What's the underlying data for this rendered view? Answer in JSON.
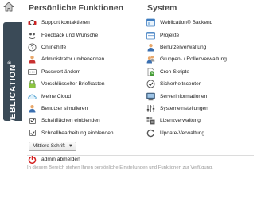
{
  "sidebar": {
    "brand": "WEBLICATION",
    "brand_mark": "®",
    "home_icon": "home-icon"
  },
  "personal": {
    "heading": "Persönliche Funktionen",
    "items": [
      {
        "label": "Support kontaktieren",
        "icon": "support-icon"
      },
      {
        "label": "Feedback und Wünsche",
        "icon": "feedback-icon"
      },
      {
        "label": "Onlinehilfe",
        "icon": "help-icon"
      },
      {
        "label": "Administrator umbenennen",
        "icon": "user-rename-icon"
      },
      {
        "label": "Passwort ändern",
        "icon": "password-icon"
      },
      {
        "label": "Verschlüsselter Briefkasten",
        "icon": "lock-icon"
      },
      {
        "label": "Meine Cloud",
        "icon": "cloud-icon"
      },
      {
        "label": "Benutzer simulieren",
        "icon": "user-simulate-icon"
      }
    ],
    "checkboxes": [
      {
        "label": "Schaltflächen einblenden",
        "checked": true
      },
      {
        "label": "Schnellbearbeitung einblenden",
        "checked": true
      }
    ],
    "font_select": {
      "value": "Mittlere Schrift"
    },
    "logout": {
      "label": "admin abmelden",
      "icon": "power-icon"
    }
  },
  "system": {
    "heading": "System",
    "items": [
      {
        "label": "Weblication® Backend",
        "icon": "backend-icon"
      },
      {
        "label": "Projekte",
        "icon": "projects-icon"
      },
      {
        "label": "Benutzerverwaltung",
        "icon": "user-management-icon"
      },
      {
        "label": "Gruppen- / Rollenverwaltung",
        "icon": "groups-icon"
      },
      {
        "label": "Cron-Skripte",
        "icon": "cron-icon"
      },
      {
        "label": "Sicherheitscenter",
        "icon": "security-icon"
      },
      {
        "label": "Serverinformationen",
        "icon": "server-icon"
      },
      {
        "label": "Systemeinstellungen",
        "icon": "settings-icon"
      },
      {
        "label": "Lizenzverwaltung",
        "icon": "license-icon"
      },
      {
        "label": "Update-Verwaltung",
        "icon": "update-icon"
      }
    ]
  },
  "info": {
    "text": "In diesem Bereich stehen Ihnen persönliche Einstellungen und Funktionen zur Verfügung."
  },
  "colors": {
    "sidebar_tab": "#3a4a57",
    "heading": "#4a4a4a",
    "logout_red": "#d42020"
  }
}
